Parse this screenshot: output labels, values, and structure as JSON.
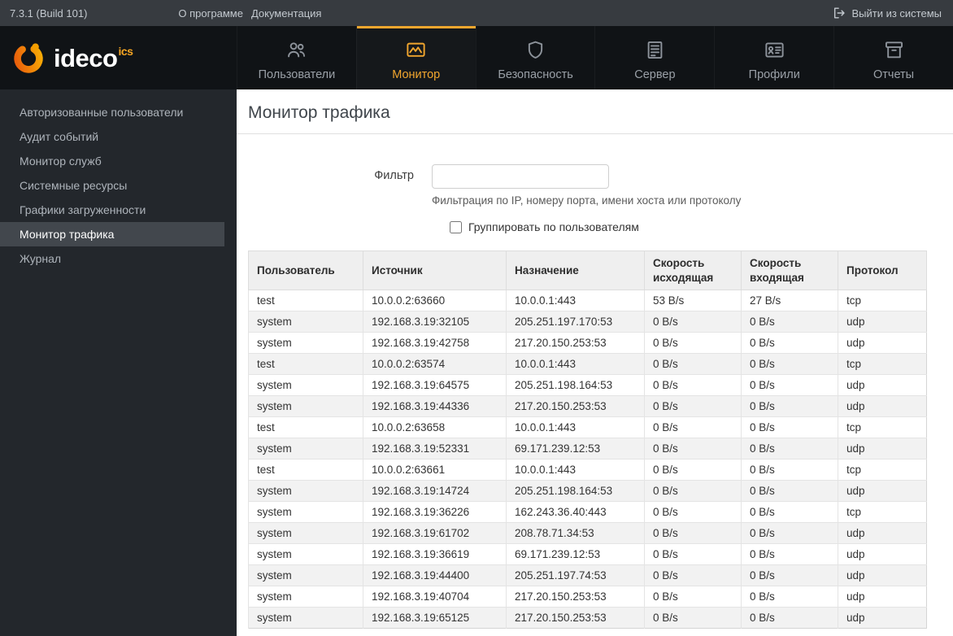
{
  "topbar": {
    "version": "7.3.1 (Build 101)",
    "about": "О программе",
    "docs": "Документация",
    "logout": "Выйти из системы"
  },
  "brand": {
    "name": "ideco",
    "suffix": "ics"
  },
  "nav": {
    "items": [
      {
        "label": "Пользователи",
        "icon": "users-icon",
        "active": false
      },
      {
        "label": "Монитор",
        "icon": "monitor-icon",
        "active": true
      },
      {
        "label": "Безопасность",
        "icon": "shield-icon",
        "active": false
      },
      {
        "label": "Сервер",
        "icon": "server-icon",
        "active": false
      },
      {
        "label": "Профили",
        "icon": "profiles-icon",
        "active": false
      },
      {
        "label": "Отчеты",
        "icon": "reports-icon",
        "active": false
      }
    ]
  },
  "sidebar": {
    "items": [
      {
        "label": "Авторизованные пользователи",
        "active": false
      },
      {
        "label": "Аудит событий",
        "active": false
      },
      {
        "label": "Монитор служб",
        "active": false
      },
      {
        "label": "Системные ресурсы",
        "active": false
      },
      {
        "label": "Графики загруженности",
        "active": false
      },
      {
        "label": "Монитор трафика",
        "active": true
      },
      {
        "label": "Журнал",
        "active": false
      }
    ]
  },
  "main": {
    "title": "Монитор трафика",
    "filter": {
      "label": "Фильтр",
      "value": "",
      "help": "Фильтрация по IP, номеру порта, имени хоста или протоколу"
    },
    "group_checkbox": {
      "label": "Группировать по пользователям",
      "checked": false
    }
  },
  "table": {
    "headers": [
      "Пользователь",
      "Источник",
      "Назначение",
      "Скорость исходящая",
      "Скорость входящая",
      "Протокол"
    ],
    "rows": [
      [
        "test",
        "10.0.0.2:63660",
        "10.0.0.1:443",
        "53 B/s",
        "27 B/s",
        "tcp"
      ],
      [
        "system",
        "192.168.3.19:32105",
        "205.251.197.170:53",
        "0 B/s",
        "0 B/s",
        "udp"
      ],
      [
        "system",
        "192.168.3.19:42758",
        "217.20.150.253:53",
        "0 B/s",
        "0 B/s",
        "udp"
      ],
      [
        "test",
        "10.0.0.2:63574",
        "10.0.0.1:443",
        "0 B/s",
        "0 B/s",
        "tcp"
      ],
      [
        "system",
        "192.168.3.19:64575",
        "205.251.198.164:53",
        "0 B/s",
        "0 B/s",
        "udp"
      ],
      [
        "system",
        "192.168.3.19:44336",
        "217.20.150.253:53",
        "0 B/s",
        "0 B/s",
        "udp"
      ],
      [
        "test",
        "10.0.0.2:63658",
        "10.0.0.1:443",
        "0 B/s",
        "0 B/s",
        "tcp"
      ],
      [
        "system",
        "192.168.3.19:52331",
        "69.171.239.12:53",
        "0 B/s",
        "0 B/s",
        "udp"
      ],
      [
        "test",
        "10.0.0.2:63661",
        "10.0.0.1:443",
        "0 B/s",
        "0 B/s",
        "tcp"
      ],
      [
        "system",
        "192.168.3.19:14724",
        "205.251.198.164:53",
        "0 B/s",
        "0 B/s",
        "udp"
      ],
      [
        "system",
        "192.168.3.19:36226",
        "162.243.36.40:443",
        "0 B/s",
        "0 B/s",
        "tcp"
      ],
      [
        "system",
        "192.168.3.19:61702",
        "208.78.71.34:53",
        "0 B/s",
        "0 B/s",
        "udp"
      ],
      [
        "system",
        "192.168.3.19:36619",
        "69.171.239.12:53",
        "0 B/s",
        "0 B/s",
        "udp"
      ],
      [
        "system",
        "192.168.3.19:44400",
        "205.251.197.74:53",
        "0 B/s",
        "0 B/s",
        "udp"
      ],
      [
        "system",
        "192.168.3.19:40704",
        "217.20.150.253:53",
        "0 B/s",
        "0 B/s",
        "udp"
      ],
      [
        "system",
        "192.168.3.19:65125",
        "217.20.150.253:53",
        "0 B/s",
        "0 B/s",
        "udp"
      ]
    ]
  },
  "colors": {
    "accent_orange": "#f2a62e",
    "topbar_bg": "#373b40",
    "navbar_bg": "#101316",
    "sidebar_bg": "#23272c",
    "sidebar_active_bg": "#42474d"
  }
}
